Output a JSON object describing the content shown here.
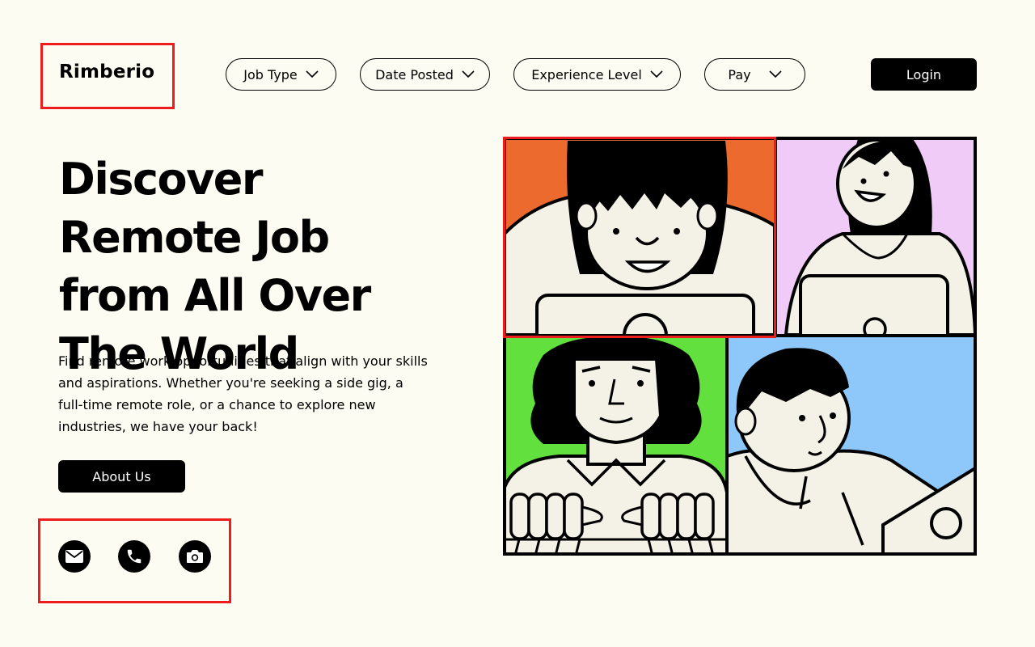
{
  "brand": {
    "name": "Rimberio"
  },
  "nav": {
    "filters": [
      {
        "label": "Job Type"
      },
      {
        "label": "Date Posted"
      },
      {
        "label": "Experience Level"
      },
      {
        "label": "Pay"
      }
    ],
    "login_label": "Login"
  },
  "hero": {
    "title": "Discover Remote Job from All Over The World",
    "description": "Find remote work opportunities that align with your skills and aspirations. Whether you're seeking a side gig, a full-time remote role, or a chance to explore new industries, we have your back!",
    "about_label": "About Us"
  },
  "social": [
    {
      "icon": "mail-icon"
    },
    {
      "icon": "phone-icon"
    },
    {
      "icon": "camera-icon"
    }
  ],
  "illustration": {
    "panel_colors": [
      "#ec6a2e",
      "#f1cbf7",
      "#62e03d",
      "#8ec8fb"
    ]
  },
  "colors": {
    "background": "#fdfcf2",
    "highlight": "#ee1c1c",
    "button": "#000000"
  }
}
